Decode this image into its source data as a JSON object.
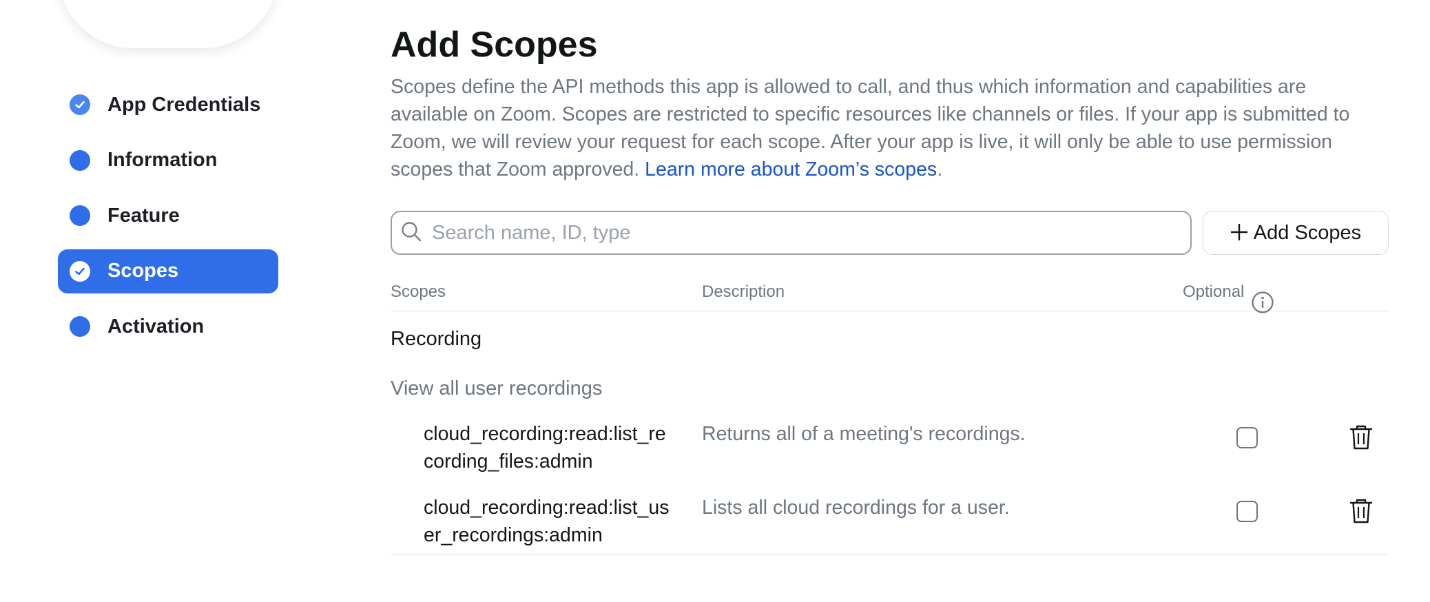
{
  "sidebar": {
    "items": [
      {
        "label": "App Credentials",
        "state": "done"
      },
      {
        "label": "Information",
        "state": "todo"
      },
      {
        "label": "Feature",
        "state": "todo"
      },
      {
        "label": "Scopes",
        "state": "active"
      },
      {
        "label": "Activation",
        "state": "todo"
      }
    ]
  },
  "main": {
    "title": "Add Scopes",
    "description": "Scopes define the API methods this app is allowed to call, and thus which information and capabilities are available on Zoom. Scopes are restricted to specific resources like channels or files. If your app is submitted to Zoom, we will review your request for each scope. After your app is live, it will only be able to use permission scopes that Zoom approved.",
    "learn_more_link": "Learn more about Zoom’s scopes",
    "learn_more_suffix": ".",
    "search": {
      "placeholder": "Search name, ID, type",
      "value": ""
    },
    "add_button_label": "Add Scopes",
    "table": {
      "headers": {
        "scopes": "Scopes",
        "description": "Description",
        "optional": "Optional"
      },
      "section": "Recording",
      "subsection": "View all user recordings",
      "rows": [
        {
          "name": "cloud_recording:read:list_recording_files:admin",
          "description": "Returns all of a meeting's recordings.",
          "optional": false
        },
        {
          "name": "cloud_recording:read:list_user_recordings:admin",
          "description": "Lists all cloud recordings for a user.",
          "optional": false
        }
      ]
    }
  },
  "colors": {
    "accent": "#2f6ee8",
    "link": "#1a55c6",
    "muted_text": "#6e7681"
  },
  "icons": {
    "done": "check-circle-icon",
    "search": "search-icon",
    "add": "plus-icon",
    "info": "info-icon",
    "delete": "trash-icon"
  }
}
